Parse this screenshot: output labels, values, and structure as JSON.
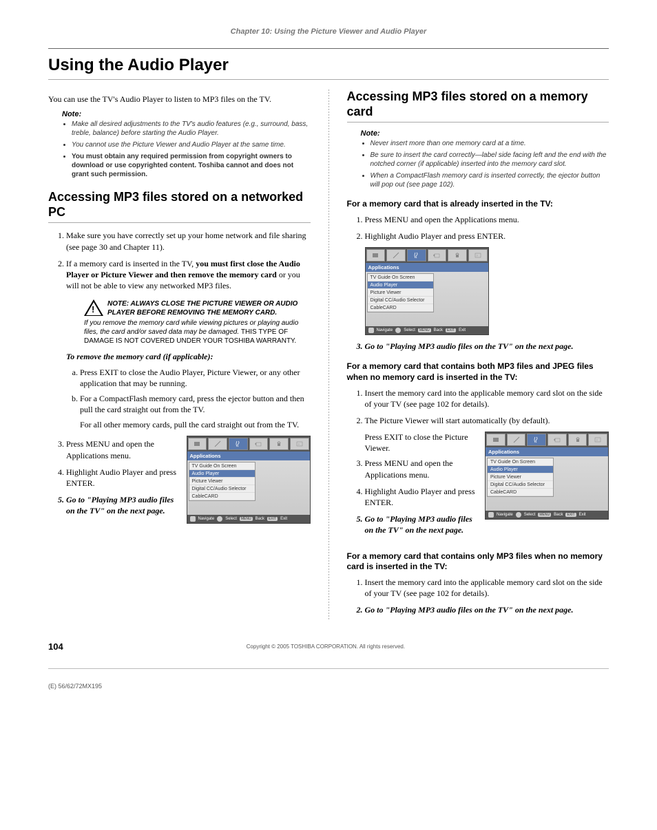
{
  "chapter": "Chapter 10: Using the Picture Viewer and Audio Player",
  "main_title": "Using the Audio Player",
  "left": {
    "intro": "You can use the TV's Audio Player to listen to MP3 files on the TV.",
    "note_label": "Note:",
    "notes": [
      "Make all desired adjustments to the TV's audio features (e.g., surround, bass, treble, balance) before starting the Audio Player.",
      "You cannot use the Picture Viewer and Audio Player at the same time.",
      "You must obtain any required permission from copyright owners to download or use copyrighted content. Toshiba cannot and does not grant such permission."
    ],
    "h2": "Accessing MP3 files stored on a networked PC",
    "step1": "Make sure you have correctly set up your home network and file sharing (see page 30 and Chapter 11).",
    "step2_a": "If a memory card is inserted in the TV, ",
    "step2_b": "you must first close the Audio Player or Picture Viewer and then remove the memory card",
    "step2_c": " or you will not be able to view any networked MP3 files.",
    "warn_title": "NOTE: ALWAYS CLOSE THE PICTURE VIEWER OR AUDIO PLAYER BEFORE REMOVING THE MEMORY CARD.",
    "warn_body_a": "If you remove the memory card while viewing pictures or playing audio files, the card and/or saved data may be damaged. ",
    "warn_body_b": "THIS TYPE OF DAMAGE IS NOT COVERED UNDER YOUR TOSHIBA WARRANTY.",
    "remove_hdr": "To remove the memory card (if applicable):",
    "sub_a": "Press EXIT to close the Audio Player, Picture Viewer, or any other application that may be running.",
    "sub_b": "For a CompactFlash memory card, press the ejector button and then pull the card straight out from the TV.",
    "sub_b2": "For all other memory cards, pull the card straight out from the TV.",
    "step3": "Press MENU and open the Applications menu.",
    "step4": "Highlight Audio Player and press ENTER.",
    "step5": "Go to \"Playing MP3 audio files on the TV\" on the next page."
  },
  "right": {
    "h2": "Accessing MP3 files stored on a memory card",
    "note_label": "Note:",
    "notes": [
      "Never insert more than one memory card at a time.",
      "Be sure to insert the card correctly—label side facing left and the end with the notched corner (if applicable) inserted into the memory card slot.",
      "When a CompactFlash memory card is inserted correctly, the ejector button will pop out (see page 102)."
    ],
    "sec1_h": "For a memory card that is already inserted in the TV:",
    "sec1_s1": "Press MENU and open the Applications menu.",
    "sec1_s2": "Highlight Audio Player and press ENTER.",
    "sec1_s3": "Go to \"Playing MP3 audio files on the TV\" on the next page.",
    "sec2_h": "For a memory card that contains both MP3 files and JPEG files when no memory card is inserted in the TV:",
    "sec2_s1": "Insert the memory card into the applicable memory card slot on the side of your TV (see page 102 for details).",
    "sec2_s2": "The Picture Viewer will start automatically (by default).",
    "sec2_s2b": "Press EXIT to close the Picture Viewer.",
    "sec2_s3": "Press MENU and open the Applications menu.",
    "sec2_s4": "Highlight Audio Player and press ENTER.",
    "sec2_s5": "Go to \"Playing MP3 audio files on the TV\" on the next page.",
    "sec3_h": "For a memory card that contains only MP3 files when no memory card is inserted in the TV:",
    "sec3_s1": "Insert the memory card into the applicable memory card slot on the side of your TV (see page 102 for details).",
    "sec3_s2": "Go to \"Playing MP3 audio files on the TV\" on the next page."
  },
  "menu": {
    "header": "Applications",
    "items": [
      "TV Guide On Screen",
      "Audio Player",
      "Picture Viewer",
      "Digital CC/Audio Selector",
      "CableCARD"
    ],
    "nav": "Navigate",
    "sel": "Select",
    "back_btn": "MENU",
    "back": "Back",
    "exit_btn": "EXIT",
    "exit": "Exit"
  },
  "footer": {
    "page": "104",
    "copyright": "Copyright © 2005 TOSHIBA CORPORATION. All rights reserved.",
    "code": "(E) 56/62/72MX195"
  }
}
